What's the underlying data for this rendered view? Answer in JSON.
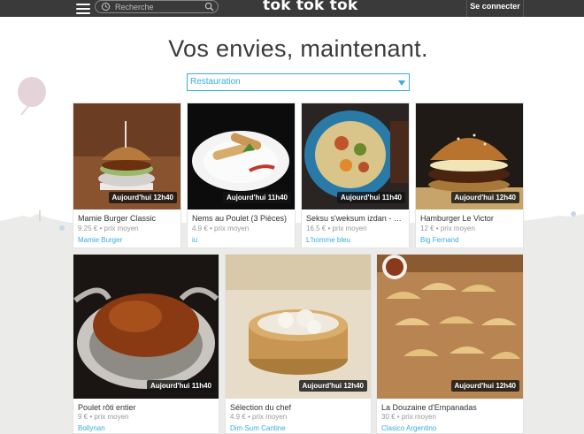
{
  "header": {
    "logo": "tok tok tok",
    "search_placeholder": "Recherche",
    "login_label": "Se connecter"
  },
  "hero": {
    "title": "Vos envies, maintenant.",
    "category_selected": "Restauration"
  },
  "colors": {
    "accent": "#39aedb",
    "topbar": "#3a3a3a",
    "skyline": "#ebebea"
  },
  "cards": [
    {
      "time": "Aujourd'hui 12h40",
      "name": "Mamie Burger Classic",
      "price": "9.25 € • prix moyen",
      "restaurant": "Mamie Burger"
    },
    {
      "time": "Aujourd'hui 11h40",
      "name": "Nems au Poulet (3 Pièces)",
      "price": "4.9 € • prix moyen",
      "restaurant": "iu"
    },
    {
      "time": "Aujourd'hui 11h40",
      "name": "Seksu s'weksum izdan - Co...",
      "price": "16.5 € • prix moyen",
      "restaurant": "L'homme bleu"
    },
    {
      "time": "Aujourd'hui 12h40",
      "name": "Hamburger Le Victor",
      "price": "12 € • prix moyen",
      "restaurant": "Big Fernand"
    },
    {
      "time": "Aujourd'hui 11h40",
      "name": "Poulet rôti entier",
      "price": "9 € • prix moyen",
      "restaurant": "Bollynan"
    },
    {
      "time": "Aujourd'hui 12h40",
      "name": "Sélection du chef",
      "price": "4.9 € • prix moyen",
      "restaurant": "Dim Sum Cantine"
    },
    {
      "time": "Aujourd'hui 12h40",
      "name": "La Douzaine d'Empanadas",
      "price": "30 € • prix moyen",
      "restaurant": "Clasico Argentino"
    }
  ]
}
